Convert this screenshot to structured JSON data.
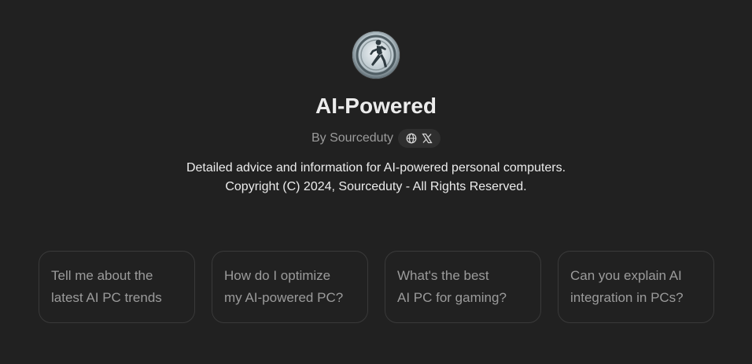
{
  "gpt": {
    "avatar_icon": "runner-avatar-icon",
    "title": "AI-Powered",
    "byline": "By Sourceduty",
    "links": [
      {
        "icon": "globe-icon"
      },
      {
        "icon": "x-logo-icon"
      }
    ],
    "description_line1": "Detailed advice and information for AI-powered personal computers.",
    "description_line2": "Copyright (C) 2024, Sourceduty - All Rights Reserved."
  },
  "starters": [
    {
      "text": "Tell me about the\nlatest AI PC trends"
    },
    {
      "text": "How do I optimize\nmy AI-powered PC?"
    },
    {
      "text": "What's the best\nAI PC for gaming?"
    },
    {
      "text": "Can you explain AI\nintegration in PCs?"
    }
  ],
  "colors": {
    "background": "#212121",
    "title": "#ececec",
    "muted": "#9b9b9b",
    "card_border": "#3a3a3a",
    "pill": "#2f2f2f"
  }
}
